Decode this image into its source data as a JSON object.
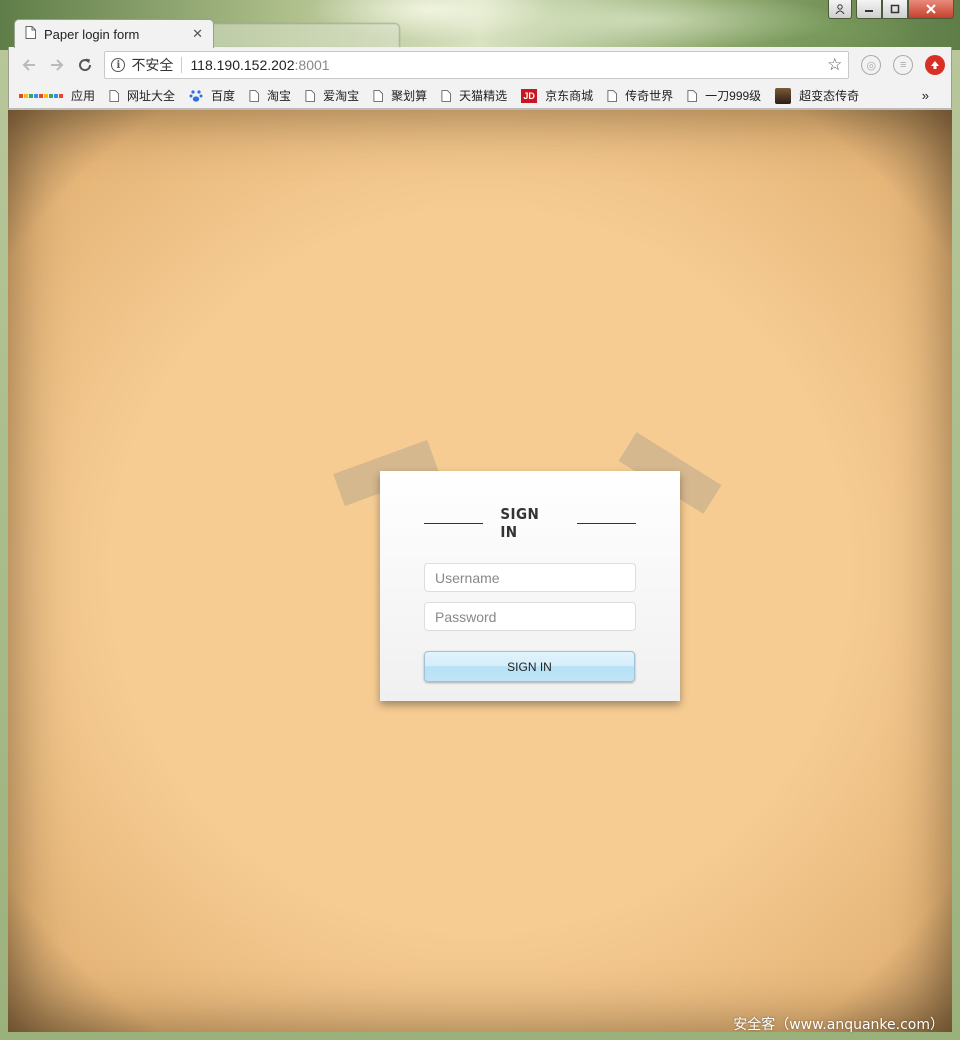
{
  "browser": {
    "active_tab_title": "Paper login form",
    "inactive_tab_title": "",
    "security_label": "不安全",
    "url_host": "118.190.152.202",
    "url_port": ":8001"
  },
  "bookmarks": [
    {
      "label": "应用",
      "icon": "apps-grid-icon"
    },
    {
      "label": "网址大全",
      "icon": "page-icon"
    },
    {
      "label": "百度",
      "icon": "baidu-paw-icon"
    },
    {
      "label": "淘宝",
      "icon": "page-icon"
    },
    {
      "label": "爱淘宝",
      "icon": "page-icon"
    },
    {
      "label": "聚划算",
      "icon": "page-icon"
    },
    {
      "label": "天猫精选",
      "icon": "page-icon"
    },
    {
      "label": "京东商城",
      "icon": "jd-icon"
    },
    {
      "label": "传奇世界",
      "icon": "page-icon"
    },
    {
      "label": "一刀999级",
      "icon": "page-icon"
    },
    {
      "label": "超变态传奇",
      "icon": "avatar-icon"
    }
  ],
  "bookmarks_more": "»",
  "login": {
    "heading": "SIGN IN",
    "username_placeholder": "Username",
    "password_placeholder": "Password",
    "submit_label": "SIGN IN"
  },
  "watermark": "安全客（www.anquanke.com）",
  "colors": {
    "paper_background": "#f6cc93",
    "card_background": "#ffffff",
    "button_blue": "#bfe4f7",
    "close_red": "#c7402c"
  }
}
